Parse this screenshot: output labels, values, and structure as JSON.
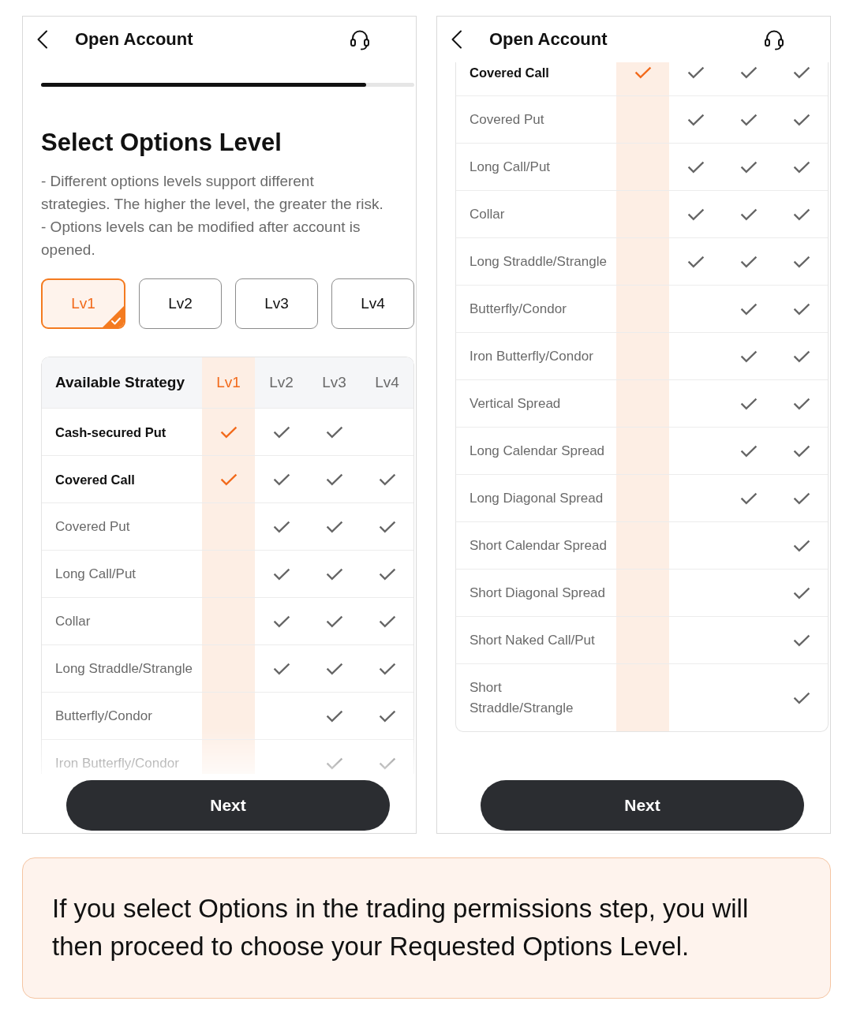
{
  "screens": [
    {
      "header": {
        "title": "Open Account"
      },
      "progress": {
        "level": 0.87
      },
      "heading": "Select Options Level",
      "description": [
        "- Different options levels support different strategies. The higher the level, the greater the risk.",
        "- Options levels can be modified after account is opened."
      ],
      "level_buttons": [
        {
          "label": "Lv1",
          "selected": true
        },
        {
          "label": "Lv2",
          "selected": false
        },
        {
          "label": "Lv3",
          "selected": false
        },
        {
          "label": "Lv4",
          "selected": false
        }
      ],
      "table": {
        "strategy_heading": "Available Strategy",
        "level_columns": [
          {
            "label": "Lv1",
            "selected": true
          },
          {
            "label": "Lv2",
            "selected": false
          },
          {
            "label": "Lv3",
            "selected": false
          },
          {
            "label": "Lv4",
            "selected": false
          }
        ],
        "rows": [
          {
            "name": "Cash-secured Put",
            "checks": [
              true,
              true,
              true,
              false
            ]
          },
          {
            "name": "Covered Call",
            "checks": [
              true,
              true,
              true,
              true
            ]
          },
          {
            "name": "Covered Put",
            "checks": [
              false,
              true,
              true,
              true
            ]
          },
          {
            "name": "Long Call/Put",
            "checks": [
              false,
              true,
              true,
              true
            ]
          },
          {
            "name": "Collar",
            "checks": [
              false,
              true,
              true,
              true
            ]
          },
          {
            "name": "Long Straddle/Strangle",
            "checks": [
              false,
              true,
              true,
              true
            ]
          },
          {
            "name": "Butterfly/Condor",
            "checks": [
              false,
              false,
              true,
              true
            ]
          },
          {
            "name": "Iron Butterfly/Condor",
            "checks": [
              false,
              false,
              true,
              true
            ]
          }
        ]
      },
      "next_button": "Next"
    },
    {
      "header": {
        "title": "Open Account"
      },
      "table": {
        "level_columns": [
          {
            "selected": true
          },
          {
            "selected": false
          },
          {
            "selected": false
          },
          {
            "selected": false
          }
        ],
        "rows": [
          {
            "name": "Covered Call",
            "checks": [
              true,
              true,
              true,
              true
            ]
          },
          {
            "name": "Covered Put",
            "checks": [
              false,
              true,
              true,
              true
            ]
          },
          {
            "name": "Long Call/Put",
            "checks": [
              false,
              true,
              true,
              true
            ]
          },
          {
            "name": "Collar",
            "checks": [
              false,
              true,
              true,
              true
            ]
          },
          {
            "name": "Long Straddle/Strangle",
            "checks": [
              false,
              true,
              true,
              true
            ]
          },
          {
            "name": "Butterfly/Condor",
            "checks": [
              false,
              false,
              true,
              true
            ]
          },
          {
            "name": "Iron Butterfly/Condor",
            "checks": [
              false,
              false,
              true,
              true
            ]
          },
          {
            "name": "Vertical Spread",
            "checks": [
              false,
              false,
              true,
              true
            ]
          },
          {
            "name": "Long Calendar Spread",
            "checks": [
              false,
              false,
              true,
              true
            ]
          },
          {
            "name": "Long Diagonal Spread",
            "checks": [
              false,
              false,
              true,
              true
            ]
          },
          {
            "name": "Short Calendar Spread",
            "checks": [
              false,
              false,
              false,
              true
            ]
          },
          {
            "name": "Short Diagonal Spread",
            "checks": [
              false,
              false,
              false,
              true
            ]
          },
          {
            "name": "Short Naked Call/Put",
            "checks": [
              false,
              false,
              false,
              true
            ]
          },
          {
            "name": "Short Straddle/Strangle",
            "checks": [
              false,
              false,
              false,
              true
            ]
          }
        ]
      },
      "next_button": "Next"
    }
  ],
  "note": "If you select Options in the trading permissions step, you will then proceed to choose your Requested Options Level."
}
